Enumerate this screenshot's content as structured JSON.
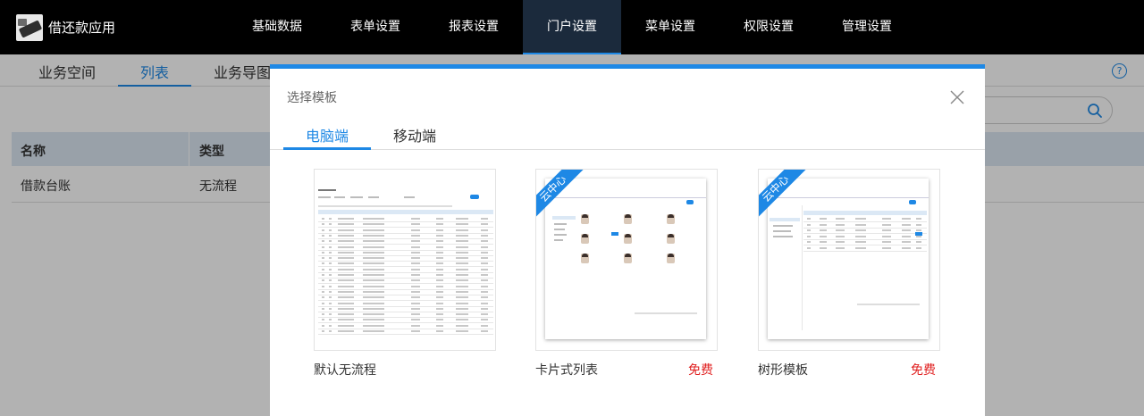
{
  "app": {
    "title": "借还款应用"
  },
  "nav": {
    "items": [
      {
        "label": "基础数据"
      },
      {
        "label": "表单设置"
      },
      {
        "label": "报表设置"
      },
      {
        "label": "门户设置",
        "active": true
      },
      {
        "label": "菜单设置"
      },
      {
        "label": "权限设置"
      },
      {
        "label": "管理设置"
      }
    ]
  },
  "subtabs": [
    {
      "label": "业务空间"
    },
    {
      "label": "列表",
      "active": true
    },
    {
      "label": "业务导图"
    }
  ],
  "table": {
    "headers": [
      "名称",
      "类型"
    ],
    "rows": [
      [
        "借款台账",
        "无流程"
      ]
    ]
  },
  "help": {
    "symbol": "?"
  },
  "modal": {
    "title": "选择模板",
    "tabs": [
      {
        "label": "电脑端",
        "active": true
      },
      {
        "label": "移动端"
      }
    ],
    "templates": [
      {
        "name": "默认无流程",
        "price": "",
        "ribbon": ""
      },
      {
        "name": "卡片式列表",
        "price": "免费",
        "ribbon": "云中心"
      },
      {
        "name": "树形模板",
        "price": "免费",
        "ribbon": "云中心"
      }
    ]
  },
  "colors": {
    "accent": "#1e88e5",
    "price": "#e02020",
    "topbar": "#000000"
  },
  "icons": [
    "app-logo-icon",
    "help-icon",
    "search-icon",
    "close-icon"
  ]
}
